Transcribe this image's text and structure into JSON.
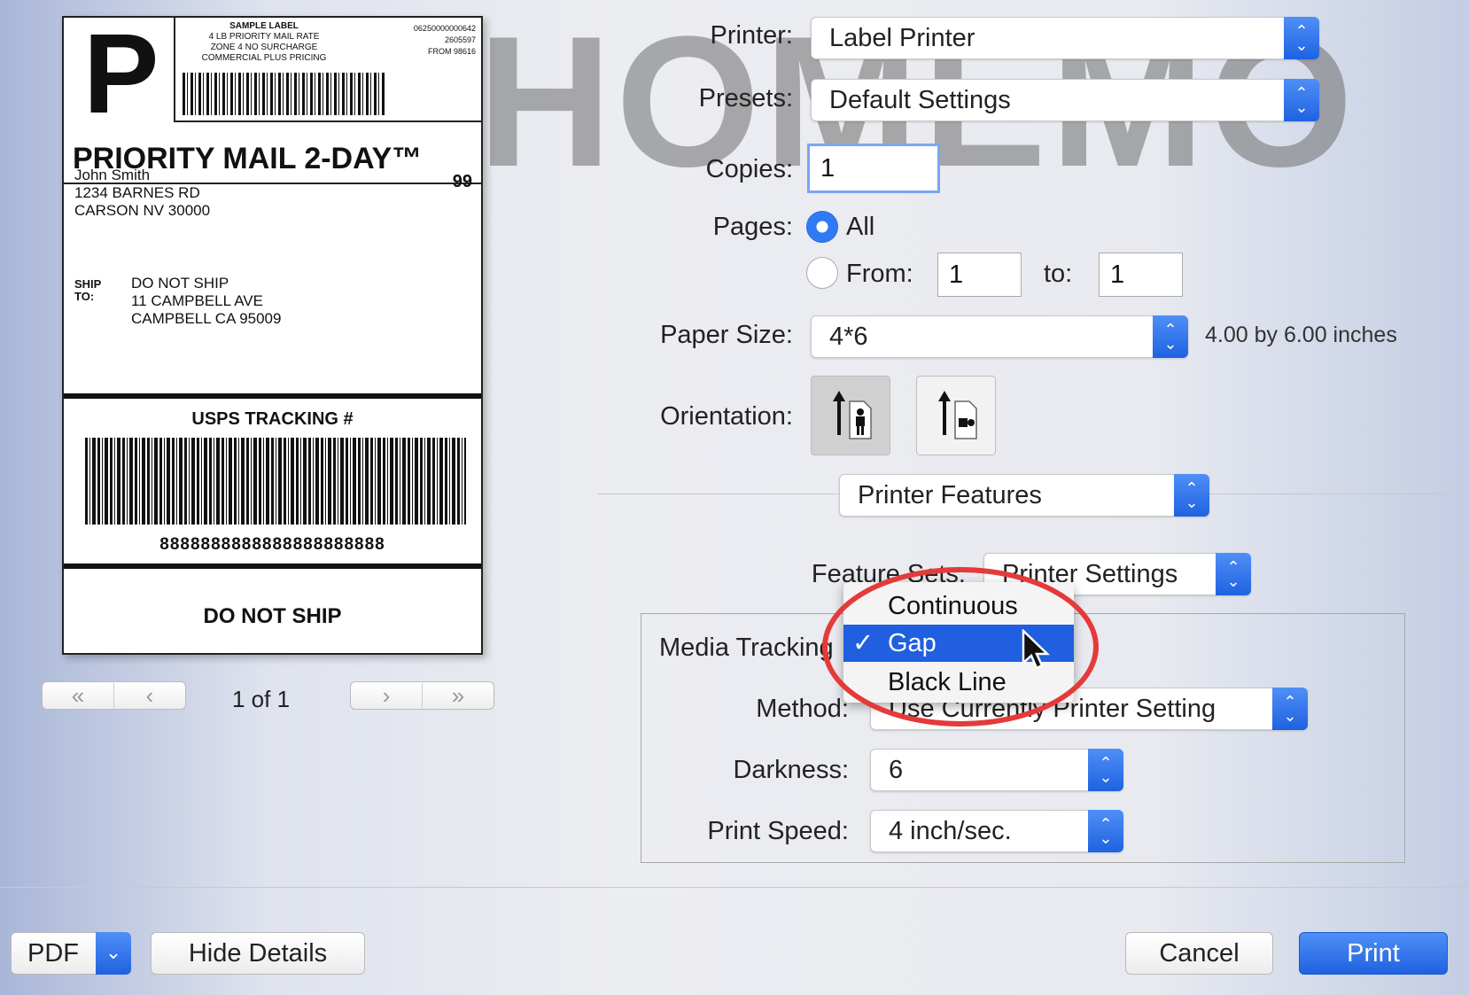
{
  "watermark": "PHOMEMO",
  "label_preview": {
    "service_letter": "P",
    "sample_header": [
      "SAMPLE LABEL",
      "4 LB PRIORITY MAIL RATE",
      "ZONE 4 NO SURCHARGE",
      "COMMERCIAL PLUS PRICING"
    ],
    "reference_numbers": [
      "06250000000642",
      "2605597",
      "FROM 98616"
    ],
    "service_title": "PRIORITY MAIL 2-DAY™",
    "sender": [
      "John Smith",
      "1234 BARNES RD",
      "CARSON NV 30000"
    ],
    "zone": "99",
    "ship_to_label": [
      "SHIP",
      "TO:"
    ],
    "recipient": [
      "DO NOT SHIP",
      "11 CAMPBELL AVE",
      "CAMPBELL CA 95009"
    ],
    "tracking_title": "USPS TRACKING #",
    "tracking_number": "8888888888888888888888",
    "footer": "DO NOT SHIP"
  },
  "pager": {
    "first": "«",
    "prev": "‹",
    "next": "›",
    "last": "»",
    "page_count": "1 of 1"
  },
  "form": {
    "printer_label": "Printer:",
    "printer_value": "Label Printer",
    "presets_label": "Presets:",
    "presets_value": "Default Settings",
    "copies_label": "Copies:",
    "copies_value": "1",
    "pages_label": "Pages:",
    "pages_all": "All",
    "pages_from": "From:",
    "pages_from_value": "1",
    "pages_to": "to:",
    "pages_to_value": "1",
    "paper_size_label": "Paper Size:",
    "paper_size_value": "4*6",
    "paper_size_info": "4.00 by 6.00 inches",
    "orientation_label": "Orientation:",
    "section_value": "Printer Features",
    "feature_sets_label": "Feature Sets:",
    "feature_sets_value": "Printer Settings",
    "media_tracking_label": "Media Tracking",
    "method_label": "Method:",
    "method_value": "Use Currently Printer Setting",
    "darkness_label": "Darkness:",
    "darkness_value": "6",
    "print_speed_label": "Print Speed:",
    "print_speed_value": "4 inch/sec."
  },
  "media_tracking_menu": {
    "items": [
      "Continuous",
      "Gap",
      "Black Line"
    ],
    "selected": "Gap",
    "check": "✓"
  },
  "footer": {
    "pdf": "PDF",
    "hide_details": "Hide Details",
    "cancel": "Cancel",
    "print": "Print"
  },
  "colors": {
    "accent": "#1f62e0",
    "highlight_ring": "#e53a3a"
  }
}
